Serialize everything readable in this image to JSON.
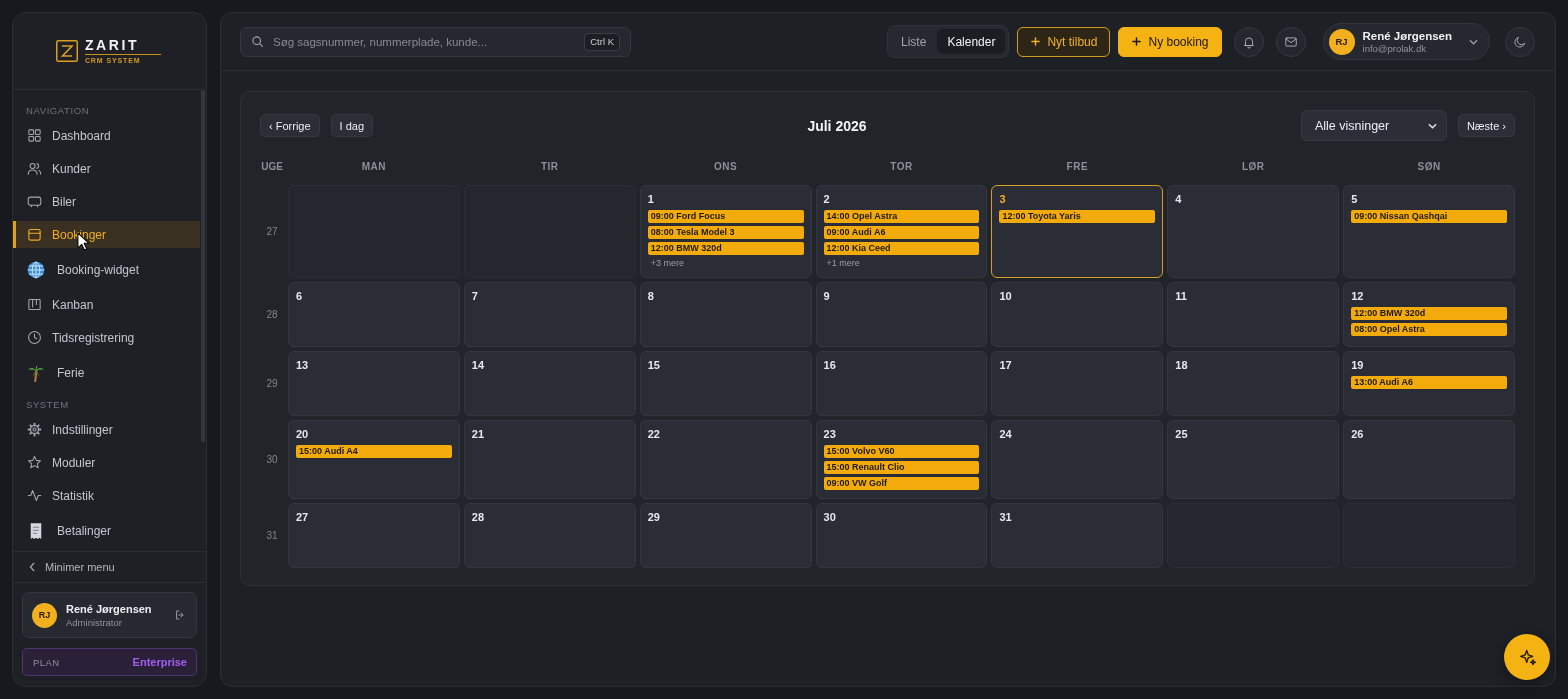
{
  "sidebar": {
    "logo": {
      "name": "ZARIT",
      "tagline": "CRM SYSTEM"
    },
    "sections": [
      {
        "title": "NAVIGATION",
        "items": [
          {
            "label": "Dashboard",
            "selected": false
          },
          {
            "label": "Kunder",
            "selected": false
          },
          {
            "label": "Biler",
            "selected": false
          },
          {
            "label": "Bookinger",
            "selected": true
          },
          {
            "label": "Booking-widget",
            "selected": false
          },
          {
            "label": "Kanban",
            "selected": false
          },
          {
            "label": "Tidsregistrering",
            "selected": false
          },
          {
            "label": "Ferie",
            "selected": false
          }
        ]
      },
      {
        "title": "SYSTEM",
        "items": [
          {
            "label": "Indstillinger",
            "selected": false
          },
          {
            "label": "Moduler",
            "selected": false
          },
          {
            "label": "Statistik",
            "selected": false
          },
          {
            "label": "Betalinger",
            "selected": false
          }
        ]
      }
    ],
    "collapse_button": "Minimer menu",
    "user": {
      "initials": "RJ",
      "name": "René Jørgensen",
      "role": "Administrator"
    },
    "plan": {
      "label": "PLAN",
      "value": "Enterprise"
    }
  },
  "topbar": {
    "search": {
      "placeholder": "Søg sagsnummer, nummerplade, kunde...",
      "shortcut": "Ctrl K"
    },
    "view_toggle": [
      {
        "label": "Liste",
        "selected": false
      },
      {
        "label": "Kalender",
        "selected": true
      }
    ],
    "buttons": [
      {
        "label": "Nyt tilbud",
        "kind": "outline"
      },
      {
        "label": "Ny booking",
        "kind": "filled"
      }
    ],
    "user": {
      "initials": "RJ",
      "name": "René Jørgensen",
      "email": "info@prolak.dk"
    }
  },
  "calendar": {
    "prev_button": "‹ Forrige",
    "today_button": "I dag",
    "title": "Juli 2026",
    "filter": {
      "value": "Alle visninger"
    },
    "next_button": "Næste ›",
    "week_label": "UGE",
    "weekdays": [
      "MAN",
      "TIR",
      "ONS",
      "TOR",
      "FRE",
      "LØR",
      "SØN"
    ],
    "weeks": [
      {
        "number": "27",
        "days": [
          {
            "kind": "empty"
          },
          {
            "kind": "empty"
          },
          {
            "kind": "day",
            "date": "1",
            "today": false,
            "events": [
              "09:00 Ford Focus",
              "08:00 Tesla Model 3",
              "12:00 BMW 320d"
            ],
            "more": "+3 mere"
          },
          {
            "kind": "day",
            "date": "2",
            "today": false,
            "events": [
              "14:00 Opel Astra",
              "09:00 Audi A6",
              "12:00 Kia Ceed"
            ],
            "more": "+1 mere"
          },
          {
            "kind": "day",
            "date": "3",
            "today": true,
            "events": [
              "12:00 Toyota Yaris"
            ]
          },
          {
            "kind": "day",
            "date": "4",
            "today": false
          },
          {
            "kind": "day",
            "date": "5",
            "today": false,
            "events": [
              "09:00 Nissan Qashqai"
            ]
          }
        ]
      },
      {
        "number": "28",
        "days": [
          {
            "kind": "day",
            "date": "6",
            "today": false
          },
          {
            "kind": "day",
            "date": "7",
            "today": false
          },
          {
            "kind": "day",
            "date": "8",
            "today": false
          },
          {
            "kind": "day",
            "date": "9",
            "today": false
          },
          {
            "kind": "day",
            "date": "10",
            "today": false
          },
          {
            "kind": "day",
            "date": "11",
            "today": false
          },
          {
            "kind": "day",
            "date": "12",
            "today": false,
            "events": [
              "12:00 BMW 320d",
              "08:00 Opel Astra"
            ]
          }
        ]
      },
      {
        "number": "29",
        "days": [
          {
            "kind": "day",
            "date": "13",
            "today": false
          },
          {
            "kind": "day",
            "date": "14",
            "today": false
          },
          {
            "kind": "day",
            "date": "15",
            "today": false
          },
          {
            "kind": "day",
            "date": "16",
            "today": false
          },
          {
            "kind": "day",
            "date": "17",
            "today": false
          },
          {
            "kind": "day",
            "date": "18",
            "today": false
          },
          {
            "kind": "day",
            "date": "19",
            "today": false,
            "events": [
              "13:00 Audi A6"
            ]
          }
        ]
      },
      {
        "number": "30",
        "days": [
          {
            "kind": "day",
            "date": "20",
            "today": false,
            "events": [
              "15:00 Audi A4"
            ]
          },
          {
            "kind": "day",
            "date": "21",
            "today": false
          },
          {
            "kind": "day",
            "date": "22",
            "today": false
          },
          {
            "kind": "day",
            "date": "23",
            "today": false,
            "events": [
              "15:00 Volvo V60",
              "15:00 Renault Clio",
              "09:00 VW Golf"
            ]
          },
          {
            "kind": "day",
            "date": "24",
            "today": false
          },
          {
            "kind": "day",
            "date": "25",
            "today": false
          },
          {
            "kind": "day",
            "date": "26",
            "today": false
          }
        ]
      },
      {
        "number": "31",
        "days": [
          {
            "kind": "day",
            "date": "27",
            "today": false
          },
          {
            "kind": "day",
            "date": "28",
            "today": false
          },
          {
            "kind": "day",
            "date": "29",
            "today": false
          },
          {
            "kind": "day",
            "date": "30",
            "today": false
          },
          {
            "kind": "day",
            "date": "31",
            "today": false
          },
          {
            "kind": "empty"
          },
          {
            "kind": "empty"
          }
        ]
      }
    ]
  }
}
